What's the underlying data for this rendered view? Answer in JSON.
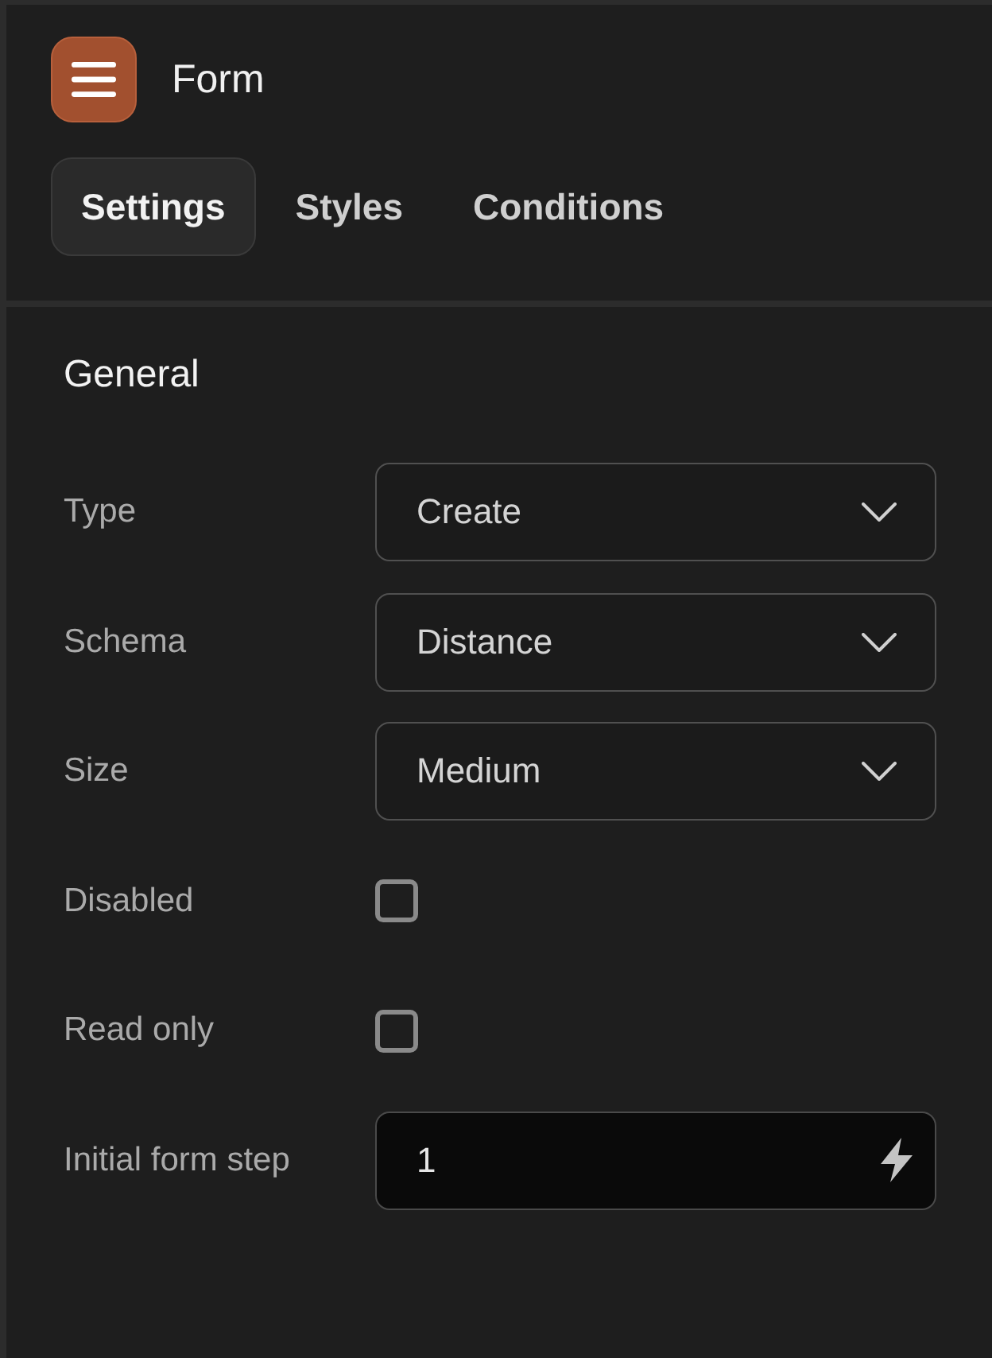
{
  "header": {
    "title": "Form"
  },
  "tabs": [
    {
      "label": "Settings",
      "selected": true
    },
    {
      "label": "Styles",
      "selected": false
    },
    {
      "label": "Conditions",
      "selected": false
    }
  ],
  "section": {
    "title": "General",
    "fields": [
      {
        "kind": "select",
        "label": "Type",
        "value": "Create"
      },
      {
        "kind": "select",
        "label": "Schema",
        "value": "Distance"
      },
      {
        "kind": "select",
        "label": "Size",
        "value": "Medium"
      },
      {
        "kind": "checkbox",
        "label": "Disabled",
        "checked": false
      },
      {
        "kind": "checkbox",
        "label": "Read only",
        "checked": false
      },
      {
        "kind": "input",
        "label": "Initial form step",
        "value": "1"
      }
    ]
  }
}
